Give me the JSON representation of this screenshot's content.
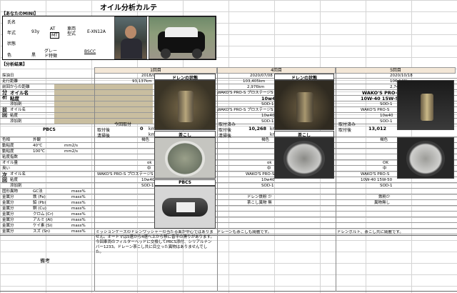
{
  "title": "オイル分析カルテ",
  "section_mini": "【あなたのMINI】",
  "profile": {
    "name_label": "氏名",
    "year_label": "年式",
    "year_value": "93y",
    "trans_top": "AT",
    "trans_bottom": "MT",
    "model_label": "車両型式",
    "model_value": "E-XN12A",
    "status_label": "状態",
    "color_label": "色",
    "color_value": "黒",
    "grade_label": "グレード特徴",
    "grade_value": "BSCC"
  },
  "section_result": "【分析結果】",
  "columns": {
    "c1": "1回目",
    "c2": "4回目",
    "c3": "5回目"
  },
  "rows": {
    "date": "採油日",
    "mileage": "走行距離",
    "since_last": "前回からの距離",
    "oil_name": "オイル名",
    "viscosity": "粘度",
    "additive": "添加剤",
    "prev_oil": "オイル名",
    "prev_visc": "粘度",
    "prev_add": "添加剤",
    "pbcs": "PBCS",
    "color": "色相",
    "appearance": "外観",
    "visc40": "動粘度",
    "visc40t": "40℃",
    "visc100": "動粘度",
    "visc100t": "100℃",
    "vi": "粘度指数",
    "oil_level": "オイル量",
    "smell": "臭い",
    "next_oil": "オイル名",
    "next_visc": "粘度",
    "next_add": "添加剤",
    "impurity": "固形異物",
    "gc": "GC法",
    "fe": "鉄 (Fe)",
    "pb": "鉛 (Pb)",
    "cu": "銅 (Cu)",
    "cr": "クロム (Cr)",
    "al": "アルミ (Al)",
    "si": "ケイ素 (Si)",
    "sn": "スズ (Sn)",
    "remarks": "備考",
    "unit_mm2": "mm2/s",
    "unit_mass": "mass%"
  },
  "side_labels": {
    "analysis": "分析",
    "prev": "前回",
    "next": "次回"
  },
  "col1": {
    "date": "2018/05/16",
    "mileage": "93,137km",
    "prev_box": "今回取付",
    "attach": "取付後",
    "attach_val": "0",
    "attach_unit": "km",
    "clean": "清掃後",
    "clean_unit": "km",
    "color": "褐色",
    "oil_level": "ok",
    "smell": "中",
    "next_oil": "WAKO'S PRO-S プロステージS",
    "next_visc": "10w40",
    "next_add": "SOD-1",
    "note": "ミッションケースのドレンワッシャーの当たる面が中心ではありません。オートマは5速から4速へ上から移に音平の滑りがあります。今回車両のフィルターヘッドに交換してPBCS添付、シリアルナンバー1233。ドレーン茶こし共に目立った異物はありませんでした。"
  },
  "photos": {
    "drain": "ドレンの状態",
    "strainer": "茶こし",
    "pbcs": "PBCS"
  },
  "col2": {
    "date": "2020/07/08",
    "mileage": "103,405km",
    "since_last": "2,976km",
    "oil_name": "WAKO'S PRO-S プロステージS",
    "viscosity": "10w40",
    "additive": "SOD-1",
    "prev_oil": "WAKO'S PRO-S プロステージS",
    "prev_visc": "10w40",
    "prev_add": "SOD-1",
    "pbcs_label": "取付済み",
    "attach": "取付後",
    "attach_val": "10,268",
    "attach_unit": "km",
    "clean": "清掃後",
    "clean_unit": "km",
    "color": "褐色",
    "oil_level": "ok",
    "smell": "中",
    "next_oil": "WAKO'S PRO-S プロステージS",
    "next_visc": "10w40",
    "next_add": "SOD-1",
    "impurity1": "ドレン鉄粉 少",
    "impurity2": "茶こし異物 無",
    "note": "ドレーンも茶こしも綺麗です。"
  },
  "col3": {
    "date": "2020/10/18",
    "mileage": "106,149km",
    "since_last": "2,744km",
    "oil_name": "WAKO'S PRO-S",
    "viscosity": "10W-40 15W-50",
    "additive": "SOD-1",
    "prev_oil": "WAKO'S PRO-S",
    "prev_visc": "10w40",
    "prev_add": "SOD-1",
    "pbcs_label": "取付済み",
    "attach": "取付後",
    "attach_val": "13,012",
    "color": "褐色",
    "oil_level": "OK",
    "smell": "中",
    "next_oil": "WAKO'S PRO-S",
    "next_visc": "10W-40 15W-50",
    "next_add": "SOD-1",
    "impurity1": "鉄粉少",
    "impurity2": "異物無し",
    "note": "ドレンボルト、茶こし共に綺麗です。"
  },
  "colors": {
    "tan": "#c9bea0",
    "peach": "#f7d9c4",
    "header": "#f3e7d7"
  }
}
